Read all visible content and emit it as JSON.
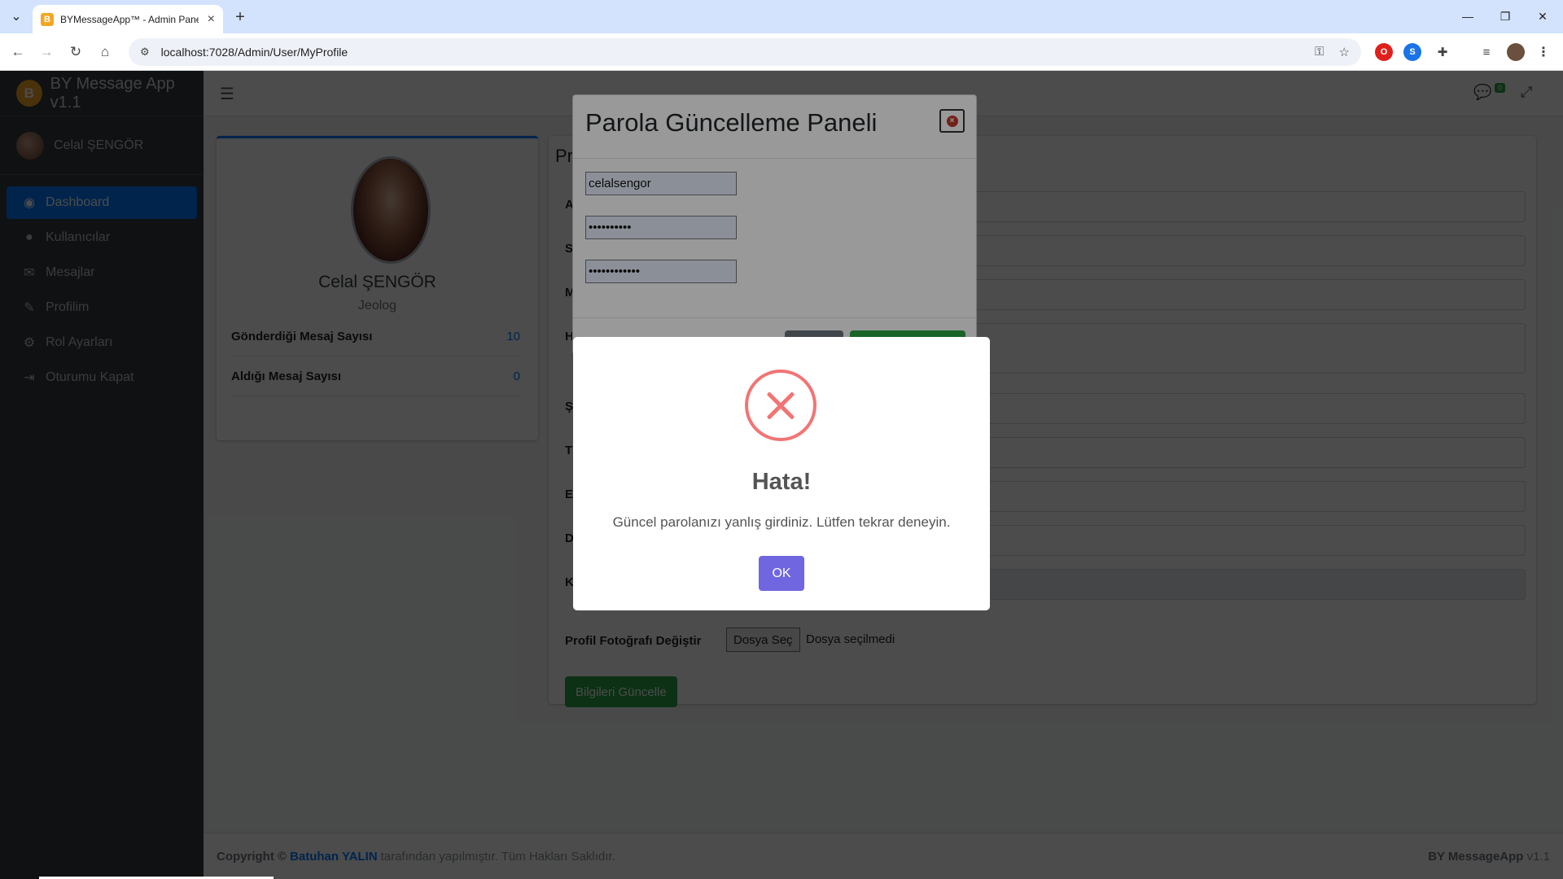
{
  "browser": {
    "tab_title": "BYMessageApp™ - Admin Pane",
    "url": "localhost:7028/Admin/User/MyProfile"
  },
  "app": {
    "brand": "BY Message App v1.1",
    "user_name": "Celal ŞENGÖR",
    "notification_count": "0",
    "menu": [
      {
        "label": "Dashboard",
        "icon": "dashboard-icon",
        "active": true
      },
      {
        "label": "Kullanıcılar",
        "icon": "user-icon",
        "active": false
      },
      {
        "label": "Mesajlar",
        "icon": "envelope-icon",
        "active": false
      },
      {
        "label": "Profilim",
        "icon": "user-edit-icon",
        "active": false
      },
      {
        "label": "Rol Ayarları",
        "icon": "cogs-icon",
        "active": false
      },
      {
        "label": "Oturumu Kapat",
        "icon": "sign-out-icon",
        "active": false
      }
    ]
  },
  "profile": {
    "name": "Celal ŞENGÖR",
    "role": "Jeolog",
    "stats": [
      {
        "label": "Gönderdiği Mesaj Sayısı",
        "value": "10"
      },
      {
        "label": "Aldığı Mesaj Sayısı",
        "value": "0"
      }
    ]
  },
  "form": {
    "title_partial": "Pr",
    "label_initials": [
      "A",
      "S",
      "M",
      "H",
      "Ş",
      "T",
      "E",
      "D",
      "K"
    ],
    "photo_label": "Profil Fotoğrafı Değiştir",
    "file_button": "Dosya Seç",
    "file_status": "Dosya seçilmedi",
    "submit": "Bilgileri Güncelle"
  },
  "password_modal": {
    "title": "Parola Güncelleme Paneli",
    "username": "celalsengor",
    "current_password_masked": "••••••••••",
    "new_password_masked": "••••••••••••"
  },
  "alert": {
    "title": "Hata!",
    "message": "Güncel parolanızı yanlış girdiniz. Lütfen tekrar deneyin.",
    "ok": "OK"
  },
  "footer": {
    "copyright": "Copyright ©",
    "author": "Batuhan YALIN",
    "rest": "tarafından yapılmıştır. Tüm Hakları Saklıdır.",
    "right_bold": "BY MessageApp",
    "right_version": "v1.1"
  }
}
